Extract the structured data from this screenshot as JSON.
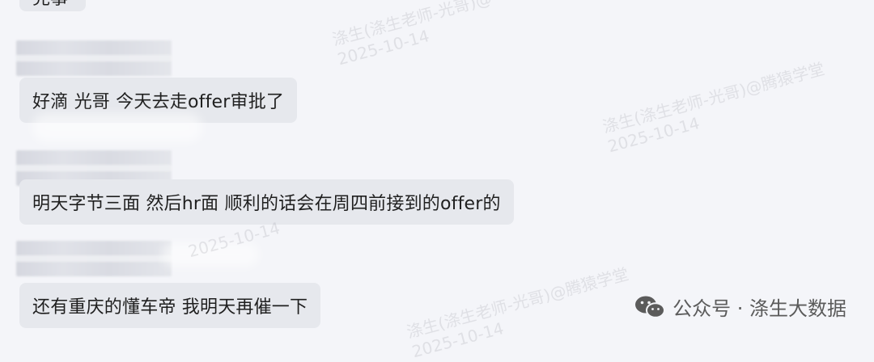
{
  "chat": {
    "top_partial_message": "完事",
    "messages": [
      {
        "text": "好滴 光哥 今天去走offer审批了"
      },
      {
        "text": "明天字节三面 然后hr面 顺利的话会在周四前接到的offer的"
      },
      {
        "text": "还有重庆的懂车帝 我明天再催一下"
      }
    ]
  },
  "watermark": {
    "line": "涤生(涤生老师-光哥)@腾猿学堂",
    "line_partial": "涤生(涤生老师-光哥)@",
    "date": "2025-10-14"
  },
  "brand": {
    "icon": "wechat-icon",
    "label": "公众号 · 涤生大数据"
  }
}
